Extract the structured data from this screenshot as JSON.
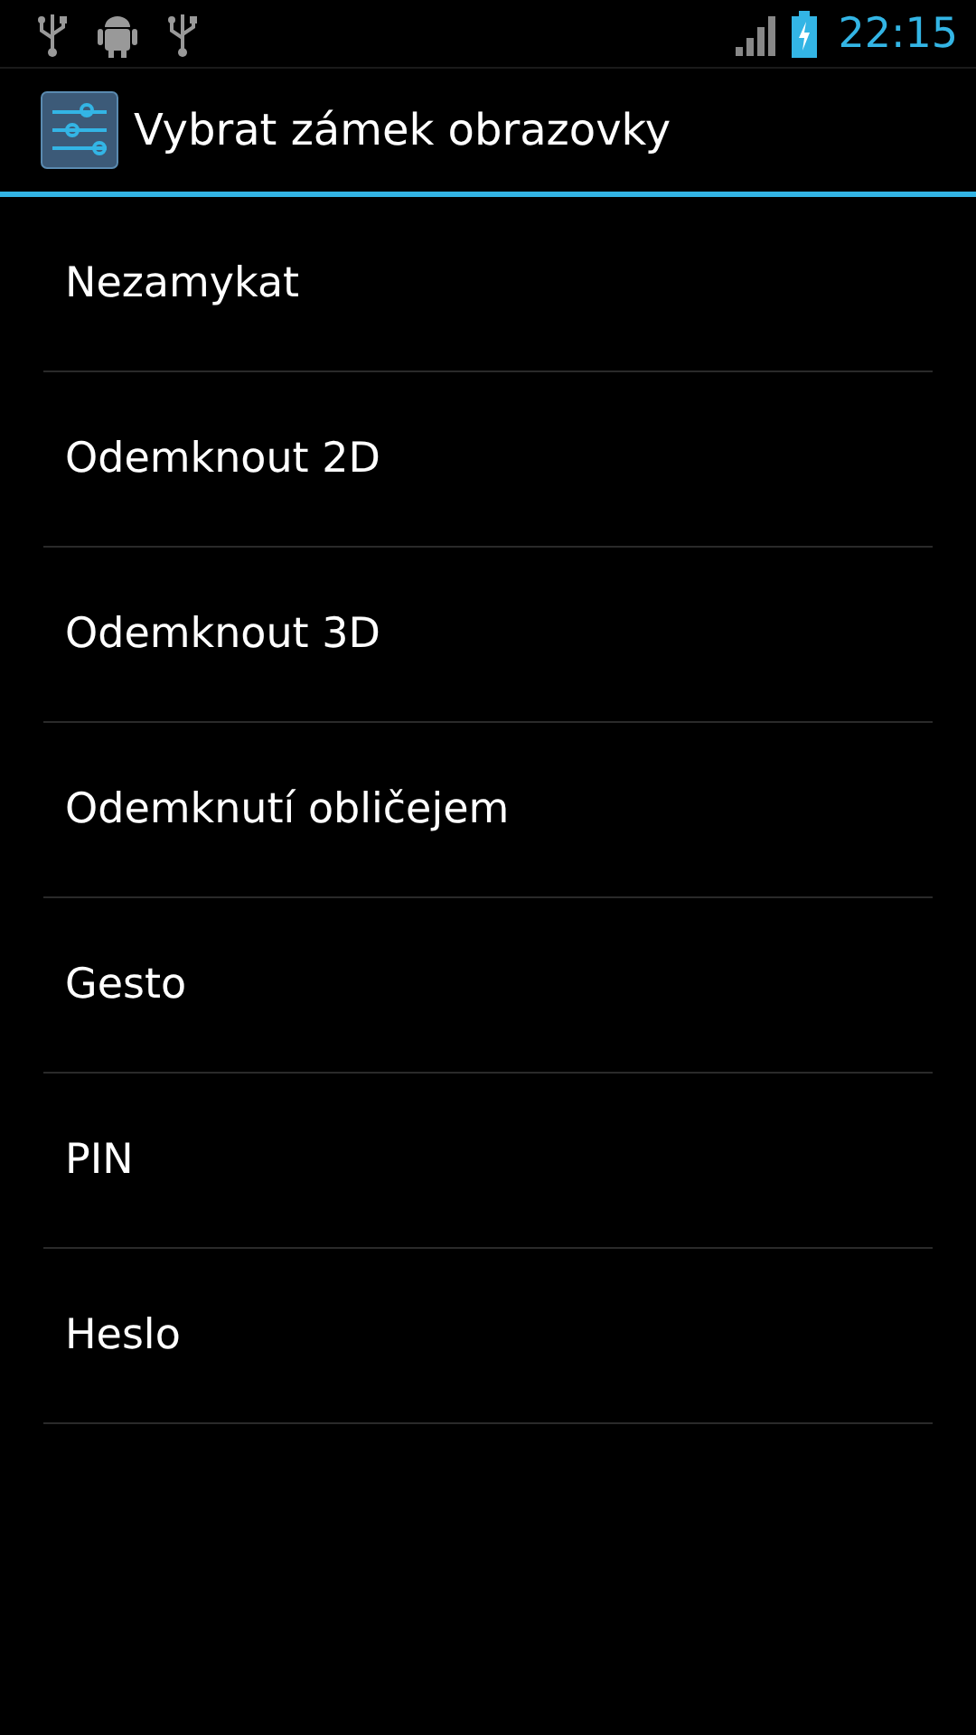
{
  "status_bar": {
    "time": "22:15"
  },
  "action_bar": {
    "title": "Vybrat zámek obrazovky"
  },
  "options": [
    {
      "label": "Nezamykat"
    },
    {
      "label": "Odemknout 2D"
    },
    {
      "label": "Odemknout 3D"
    },
    {
      "label": "Odemknutí obličejem"
    },
    {
      "label": "Gesto"
    },
    {
      "label": "PIN"
    },
    {
      "label": "Heslo"
    }
  ]
}
